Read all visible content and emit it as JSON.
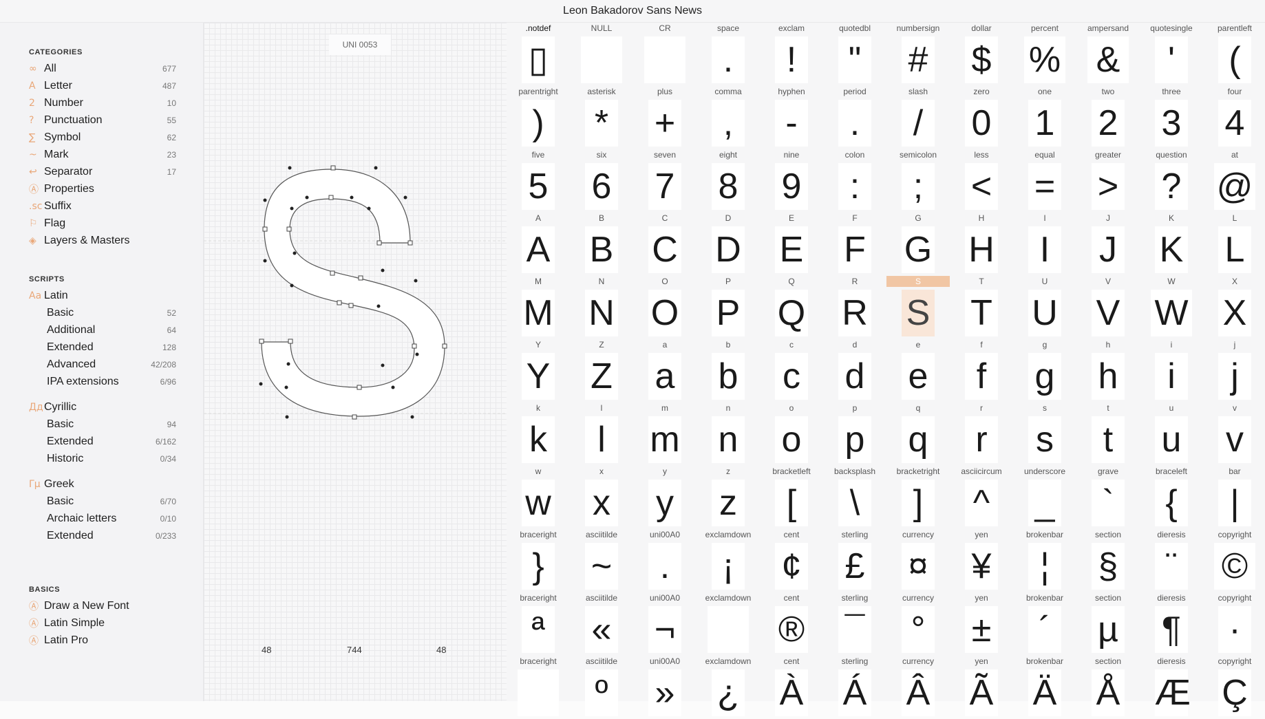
{
  "window": {
    "title": "Leon Bakadorov Sans News"
  },
  "sidebar": {
    "categories_title": "CATEGORIES",
    "categories": [
      {
        "icon": "∞",
        "label": "All",
        "count": "677"
      },
      {
        "icon": "A",
        "label": "Letter",
        "count": "487"
      },
      {
        "icon": "2",
        "label": "Number",
        "count": "10"
      },
      {
        "icon": "?",
        "label": "Punctuation",
        "count": "55"
      },
      {
        "icon": "∑",
        "label": "Symbol",
        "count": "62"
      },
      {
        "icon": "~",
        "label": "Mark",
        "count": "23"
      },
      {
        "icon": "↩",
        "label": "Separator",
        "count": "17"
      },
      {
        "icon": "Ⓐ",
        "label": "Properties",
        "count": ""
      },
      {
        "icon": ".sc",
        "label": "Suffix",
        "count": ""
      },
      {
        "icon": "⚐",
        "label": "Flag",
        "count": ""
      },
      {
        "icon": "◈",
        "label": "Layers & Masters",
        "count": ""
      }
    ],
    "scripts_title": "SCRIPTS",
    "scripts": [
      {
        "icon": "Aa",
        "label": "Latin",
        "count": "",
        "sub": false
      },
      {
        "icon": "",
        "label": "Basic",
        "count": "52",
        "sub": true
      },
      {
        "icon": "",
        "label": "Additional",
        "count": "64",
        "sub": true
      },
      {
        "icon": "",
        "label": "Extended",
        "count": "128",
        "sub": true
      },
      {
        "icon": "",
        "label": "Advanced",
        "count": "42/208",
        "sub": true
      },
      {
        "icon": "",
        "label": "IPA extensions",
        "count": "6/96",
        "sub": true
      },
      {
        "icon": "Дд",
        "label": "Cyrillic",
        "count": "",
        "sub": false
      },
      {
        "icon": "",
        "label": "Basic",
        "count": "94",
        "sub": true
      },
      {
        "icon": "",
        "label": "Extended",
        "count": "6/162",
        "sub": true
      },
      {
        "icon": "",
        "label": "Historic",
        "count": "0/34",
        "sub": true
      },
      {
        "icon": "Γμ",
        "label": "Greek",
        "count": "",
        "sub": false
      },
      {
        "icon": "",
        "label": "Basic",
        "count": "6/70",
        "sub": true
      },
      {
        "icon": "",
        "label": "Archaic letters",
        "count": "0/10",
        "sub": true
      },
      {
        "icon": "",
        "label": "Extended",
        "count": "0/233",
        "sub": true
      }
    ],
    "basics_title": "BASICS",
    "basics": [
      {
        "icon": "Ⓐ",
        "label": "Draw a New Font"
      },
      {
        "icon": "Ⓐ",
        "label": "Latin Simple"
      },
      {
        "icon": "Ⓐ",
        "label": "Latin Pro"
      }
    ]
  },
  "editor": {
    "glyph_code": "UNI 0053",
    "left_sidebearing": "48",
    "advance_width": "744",
    "right_sidebearing": "48"
  },
  "grid": {
    "selected": "S",
    "rows": [
      [
        [
          ".notdef",
          "▯"
        ],
        [
          "NULL",
          ""
        ],
        [
          "CR",
          ""
        ],
        [
          "space",
          "."
        ],
        [
          "exclam",
          "!"
        ],
        [
          "quotedbl",
          "\""
        ],
        [
          "numbersign",
          "#"
        ],
        [
          "dollar",
          "$"
        ],
        [
          "percent",
          "%"
        ],
        [
          "ampersand",
          "&"
        ],
        [
          "quotesingle",
          "'"
        ],
        [
          "parentleft",
          "("
        ]
      ],
      [
        [
          "parentright",
          ")"
        ],
        [
          "asterisk",
          "*"
        ],
        [
          "plus",
          "+"
        ],
        [
          "comma",
          ","
        ],
        [
          "hyphen",
          "-"
        ],
        [
          "period",
          "."
        ],
        [
          "slash",
          "/"
        ],
        [
          "zero",
          "0"
        ],
        [
          "one",
          "1"
        ],
        [
          "two",
          "2"
        ],
        [
          "three",
          "3"
        ],
        [
          "four",
          "4"
        ]
      ],
      [
        [
          "five",
          "5"
        ],
        [
          "six",
          "6"
        ],
        [
          "seven",
          "7"
        ],
        [
          "eight",
          "8"
        ],
        [
          "nine",
          "9"
        ],
        [
          "colon",
          ":"
        ],
        [
          "semicolon",
          ";"
        ],
        [
          "less",
          "<"
        ],
        [
          "equal",
          "="
        ],
        [
          "greater",
          ">"
        ],
        [
          "question",
          "?"
        ],
        [
          "at",
          "@"
        ]
      ],
      [
        [
          "A",
          "A"
        ],
        [
          "B",
          "B"
        ],
        [
          "C",
          "C"
        ],
        [
          "D",
          "D"
        ],
        [
          "E",
          "E"
        ],
        [
          "F",
          "F"
        ],
        [
          "G",
          "G"
        ],
        [
          "H",
          "H"
        ],
        [
          "I",
          "I"
        ],
        [
          "J",
          "J"
        ],
        [
          "K",
          "K"
        ],
        [
          "L",
          "L"
        ]
      ],
      [
        [
          "M",
          "M"
        ],
        [
          "N",
          "N"
        ],
        [
          "O",
          "O"
        ],
        [
          "P",
          "P"
        ],
        [
          "Q",
          "Q"
        ],
        [
          "R",
          "R"
        ],
        [
          "S",
          "S"
        ],
        [
          "T",
          "T"
        ],
        [
          "U",
          "U"
        ],
        [
          "V",
          "V"
        ],
        [
          "W",
          "W"
        ],
        [
          "X",
          "X"
        ]
      ],
      [
        [
          "Y",
          "Y"
        ],
        [
          "Z",
          "Z"
        ],
        [
          "a",
          "a"
        ],
        [
          "b",
          "b"
        ],
        [
          "c",
          "c"
        ],
        [
          "d",
          "d"
        ],
        [
          "e",
          "e"
        ],
        [
          "f",
          "f"
        ],
        [
          "g",
          "g"
        ],
        [
          "h",
          "h"
        ],
        [
          "i",
          "i"
        ],
        [
          "j",
          "j"
        ]
      ],
      [
        [
          "k",
          "k"
        ],
        [
          "l",
          "l"
        ],
        [
          "m",
          "m"
        ],
        [
          "n",
          "n"
        ],
        [
          "o",
          "o"
        ],
        [
          "p",
          "p"
        ],
        [
          "q",
          "q"
        ],
        [
          "r",
          "r"
        ],
        [
          "s",
          "s"
        ],
        [
          "t",
          "t"
        ],
        [
          "u",
          "u"
        ],
        [
          "v",
          "v"
        ]
      ],
      [
        [
          "w",
          "w"
        ],
        [
          "x",
          "x"
        ],
        [
          "y",
          "y"
        ],
        [
          "z",
          "z"
        ],
        [
          "bracketleft",
          "["
        ],
        [
          "backsplash",
          "\\"
        ],
        [
          "bracketright",
          "]"
        ],
        [
          "asciicircum",
          "^"
        ],
        [
          "underscore",
          "_"
        ],
        [
          "grave",
          "`"
        ],
        [
          "braceleft",
          "{"
        ],
        [
          "bar",
          "|"
        ]
      ],
      [
        [
          "braceright",
          "}"
        ],
        [
          "asciitilde",
          "~"
        ],
        [
          "uni00A0",
          "."
        ],
        [
          "exclamdown",
          "¡"
        ],
        [
          "cent",
          "¢"
        ],
        [
          "sterling",
          "£"
        ],
        [
          "currency",
          "¤"
        ],
        [
          "yen",
          "¥"
        ],
        [
          "brokenbar",
          "¦"
        ],
        [
          "section",
          "§"
        ],
        [
          "dieresis",
          "¨"
        ],
        [
          "copyright",
          "©"
        ]
      ],
      [
        [
          "braceright",
          "ª"
        ],
        [
          "asciitilde",
          "«"
        ],
        [
          "uni00A0",
          "¬"
        ],
        [
          "exclamdown",
          ""
        ],
        [
          "cent",
          "®"
        ],
        [
          "sterling",
          "¯"
        ],
        [
          "currency",
          "°"
        ],
        [
          "yen",
          "±"
        ],
        [
          "brokenbar",
          "´"
        ],
        [
          "section",
          "µ"
        ],
        [
          "dieresis",
          "¶"
        ],
        [
          "copyright",
          "·"
        ]
      ],
      [
        [
          "braceright",
          ""
        ],
        [
          "asciitilde",
          "º"
        ],
        [
          "uni00A0",
          "»"
        ],
        [
          "exclamdown",
          "¿"
        ],
        [
          "cent",
          "À"
        ],
        [
          "sterling",
          "Á"
        ],
        [
          "currency",
          "Â"
        ],
        [
          "yen",
          "Ã"
        ],
        [
          "brokenbar",
          "Ä"
        ],
        [
          "section",
          "Å"
        ],
        [
          "dieresis",
          "Æ"
        ],
        [
          "copyright",
          "Ç"
        ]
      ]
    ]
  }
}
